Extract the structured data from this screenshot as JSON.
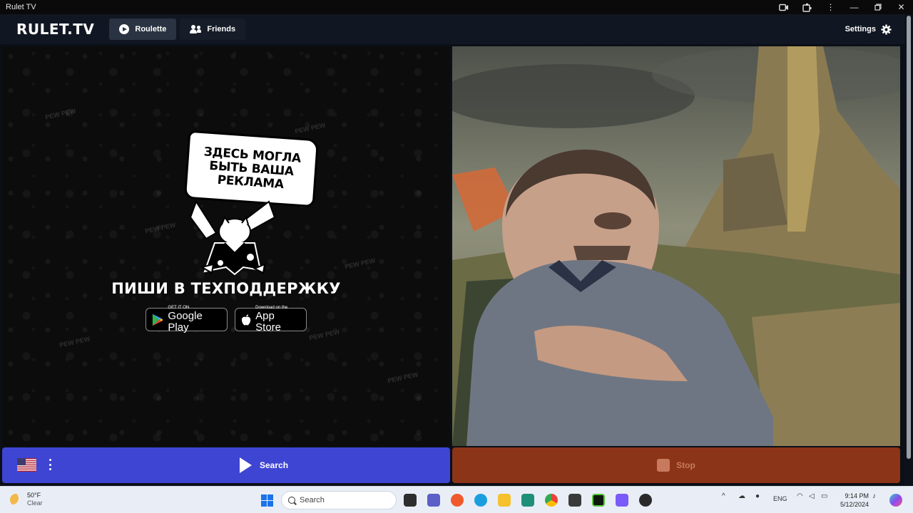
{
  "window": {
    "title": "Rulet TV"
  },
  "header": {
    "logo": "RULET.TV",
    "tabs": [
      {
        "label": "Roulette",
        "icon": "play-circle-icon",
        "active": true
      },
      {
        "label": "Friends",
        "icon": "friends-icon",
        "active": false
      }
    ],
    "settings_label": "Settings"
  },
  "ad": {
    "sign_lines": [
      "ЗДЕСЬ МОГЛА",
      "БЫТЬ ВАША",
      "РЕКЛАМА"
    ],
    "support_text": "ПИШИ В ТЕХПОДДЕРЖКУ",
    "google_play": {
      "small": "GET IT ON",
      "large": "Google Play"
    },
    "app_store": {
      "small": "Download on the",
      "large": "App Store"
    },
    "pattern_text": "PEW PEW"
  },
  "controls": {
    "country_flag": "us-flag-icon",
    "search_label": "Search",
    "stop_label": "Stop"
  },
  "colors": {
    "search_bar": "#3e45d3",
    "stop_bar": "#8c3417",
    "header_bg": "#111722"
  },
  "taskbar": {
    "weather_temp": "50°F",
    "weather_desc": "Clear",
    "search_placeholder": "Search",
    "language": "ENG",
    "time": "9:14 PM",
    "date": "5/12/2024"
  }
}
